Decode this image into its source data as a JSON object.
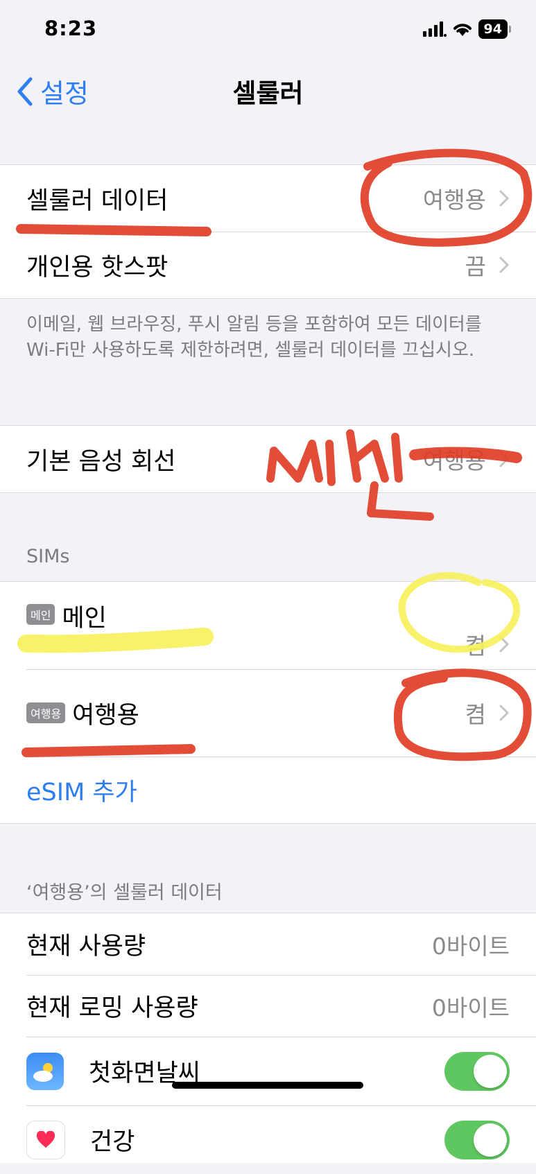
{
  "status": {
    "time": "8:23",
    "battery": "94"
  },
  "nav": {
    "back": "설정",
    "title": "셀룰러"
  },
  "group1": {
    "cellular_data": {
      "label": "셀룰러 데이터",
      "value": "여행용"
    },
    "hotspot": {
      "label": "개인용 핫스팟",
      "value": "끔"
    }
  },
  "note": "이메일, 웹 브라우징, 푸시 알림 등을 포함하여 모든 데이터를 Wi-Fi만 사용하도록 제한하려면, 셀룰러 데이터를 끄십시오.",
  "default_line": {
    "label": "기본 음성 회선",
    "value": "여행용"
  },
  "sims_header": "SIMs",
  "sims": [
    {
      "badge": "메인",
      "name": "메인",
      "value": "켬"
    },
    {
      "badge": "여행용",
      "name": "여행용",
      "value": "켬"
    }
  ],
  "add_esim": "eSIM 추가",
  "data_header": "‘여행용’의 셀룰러 데이터",
  "usage": [
    {
      "label": "현재 사용량",
      "value": "0바이트"
    },
    {
      "label": "현재 로밍 사용량",
      "value": "0바이트"
    }
  ],
  "apps": [
    {
      "name": "첫화면날씨",
      "icon": "weather-icon",
      "enabled": true
    },
    {
      "name": "건강",
      "icon": "health-heart-icon",
      "enabled": true
    }
  ],
  "annotations": {
    "handwritten": "메인",
    "red": "#e03a22",
    "yellow": "#f7f05a"
  },
  "colors": {
    "accent": "#2f7ef1",
    "toggle_on": "#5ec75f"
  }
}
